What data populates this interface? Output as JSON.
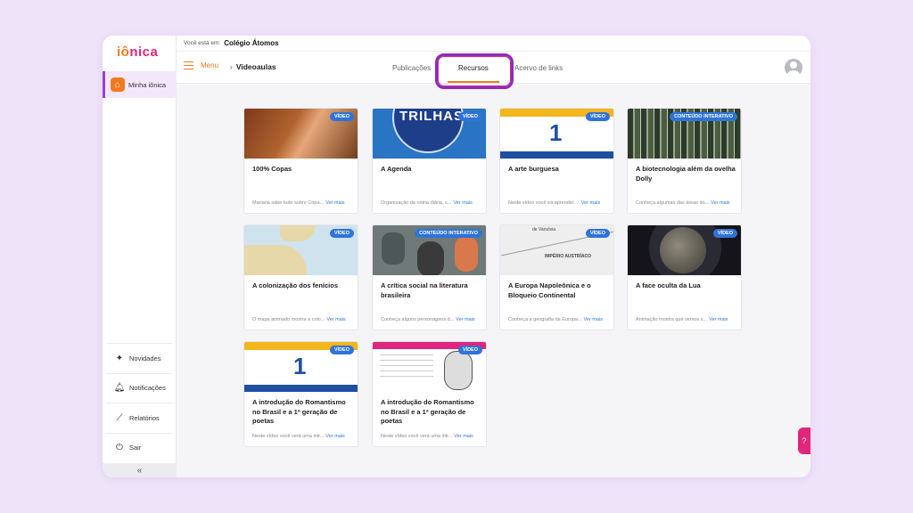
{
  "brand": {
    "logo_part1": "iô",
    "logo_part2": "nica"
  },
  "breadcrumb": {
    "prefix": "Você está em:",
    "school": "Colégio Átomos"
  },
  "sidebar": {
    "main_item": {
      "label": "Minha iônica",
      "icon": "home-icon"
    },
    "items": [
      {
        "label": "Novidades",
        "icon": "sparkle-icon"
      },
      {
        "label": "Notificações",
        "icon": "bell-icon"
      },
      {
        "label": "Relatórios",
        "icon": "chart-icon"
      },
      {
        "label": "Sair",
        "icon": "power-icon"
      }
    ],
    "collapse_glyph": "«"
  },
  "topbar": {
    "menu_label": "Menu",
    "section": "Videoaulas",
    "tabs": [
      {
        "label": "Publicações",
        "active": false
      },
      {
        "label": "Recursos",
        "active": true
      },
      {
        "label": "Acervo de links",
        "active": false
      }
    ]
  },
  "cards": [
    {
      "badge": "VÍDEO",
      "title": "100% Copas",
      "desc": "Mariana sabe tudo sobre Copa...",
      "more": "Ver mais"
    },
    {
      "badge": "VÍDEO",
      "title": "A Agenda",
      "desc": "Organização da rotina diária, c...",
      "more": "Ver mais",
      "thumb_text": "TRILHAS"
    },
    {
      "badge": "VÍDEO",
      "title": "A arte burguesa",
      "desc": "Neste vídeo você irá aprender ...",
      "more": "Ver mais",
      "thumb_text": "1"
    },
    {
      "badge": "CONTEÚDO INTERATIVO",
      "title": "A biotecnologia além da ovelha Dolly",
      "desc": "Conheça algumas das áreas do...",
      "more": "Ver mais"
    },
    {
      "badge": "VÍDEO",
      "title": "A colonização dos fenícios",
      "desc": "O mapa animado mostra a colo...",
      "more": "Ver mais"
    },
    {
      "badge": "CONTEÚDO INTERATIVO",
      "title": "A crítica social na literatura brasileira",
      "desc": "Conheça alguns personagens d...",
      "more": "Ver mais"
    },
    {
      "badge": "VÍDEO",
      "title": "A Europa Napoleônica e o Bloqueio Continental",
      "desc": "Conheça a geografia da Europa...",
      "more": "Ver mais",
      "thumb_text": "IMPÉRIO AUSTRÍACO",
      "thumb_text2": "de Varsóvia"
    },
    {
      "badge": "VÍDEO",
      "title": "A face oculta da Lua",
      "desc": "Animação mostra que vemos s...",
      "more": "Ver mais"
    },
    {
      "badge": "VÍDEO",
      "title": "A introdução do Romantismo no Brasil e a 1ª geração de poetas",
      "desc": "Neste vídeo você verá uma intr...",
      "more": "Ver mais",
      "thumb_text": "1"
    },
    {
      "badge": "VÍDEO",
      "title": "A introdução do Romantismo no Brasil e a 1ª geração de poetas",
      "desc": "Neste vídeo você verá uma intr...",
      "more": "Ver mais"
    }
  ],
  "help_glyph": "?",
  "colors": {
    "accent_orange": "#f07a1e",
    "brand_pink": "#e0267c",
    "badge_blue": "#2f73d9",
    "highlight_purple": "#8c2bbf"
  }
}
